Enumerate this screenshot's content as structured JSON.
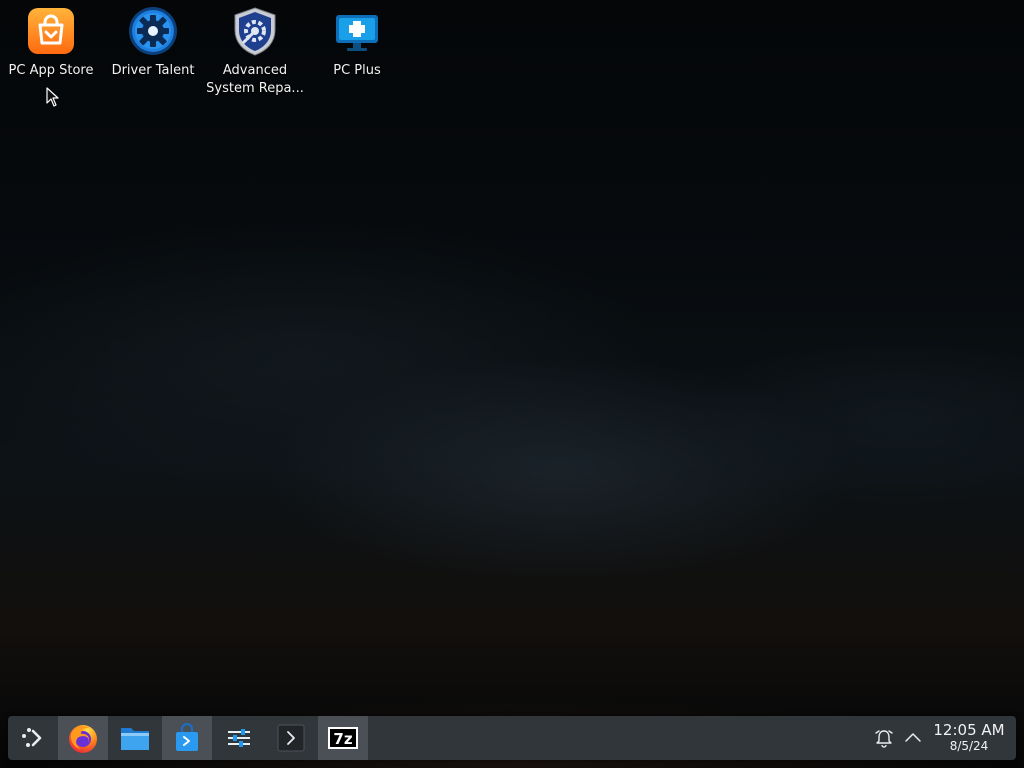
{
  "desktop": {
    "icons": [
      {
        "label": "PC App Store",
        "icon": "shopping-bag-icon"
      },
      {
        "label": "Driver Talent",
        "icon": "gear-icon"
      },
      {
        "label": "Advanced System Repa...",
        "icon": "shield-gear-icon"
      },
      {
        "label": "PC Plus",
        "icon": "monitor-plus-icon"
      }
    ]
  },
  "taskbar": {
    "items": [
      {
        "name": "application-launcher",
        "icon": "launcher-icon"
      },
      {
        "name": "firefox",
        "icon": "firefox-icon"
      },
      {
        "name": "file-manager",
        "icon": "folder-icon"
      },
      {
        "name": "discover",
        "icon": "store-bag-icon"
      },
      {
        "name": "system-settings",
        "icon": "sliders-icon"
      },
      {
        "name": "konsole",
        "icon": "terminal-icon"
      },
      {
        "name": "7-zip",
        "icon": "7z-icon",
        "text": "7z"
      }
    ],
    "tray": {
      "notifications_icon": "bell-icon",
      "expand_icon": "chevron-up-icon"
    },
    "clock": {
      "time": "12:05 AM",
      "date": "8/5/24"
    }
  },
  "colors": {
    "taskbar_bg": "#31363b",
    "appstore_orange": "#ff8a1c",
    "driver_blue": "#1d7fe0",
    "text": "#f2f2f2"
  }
}
